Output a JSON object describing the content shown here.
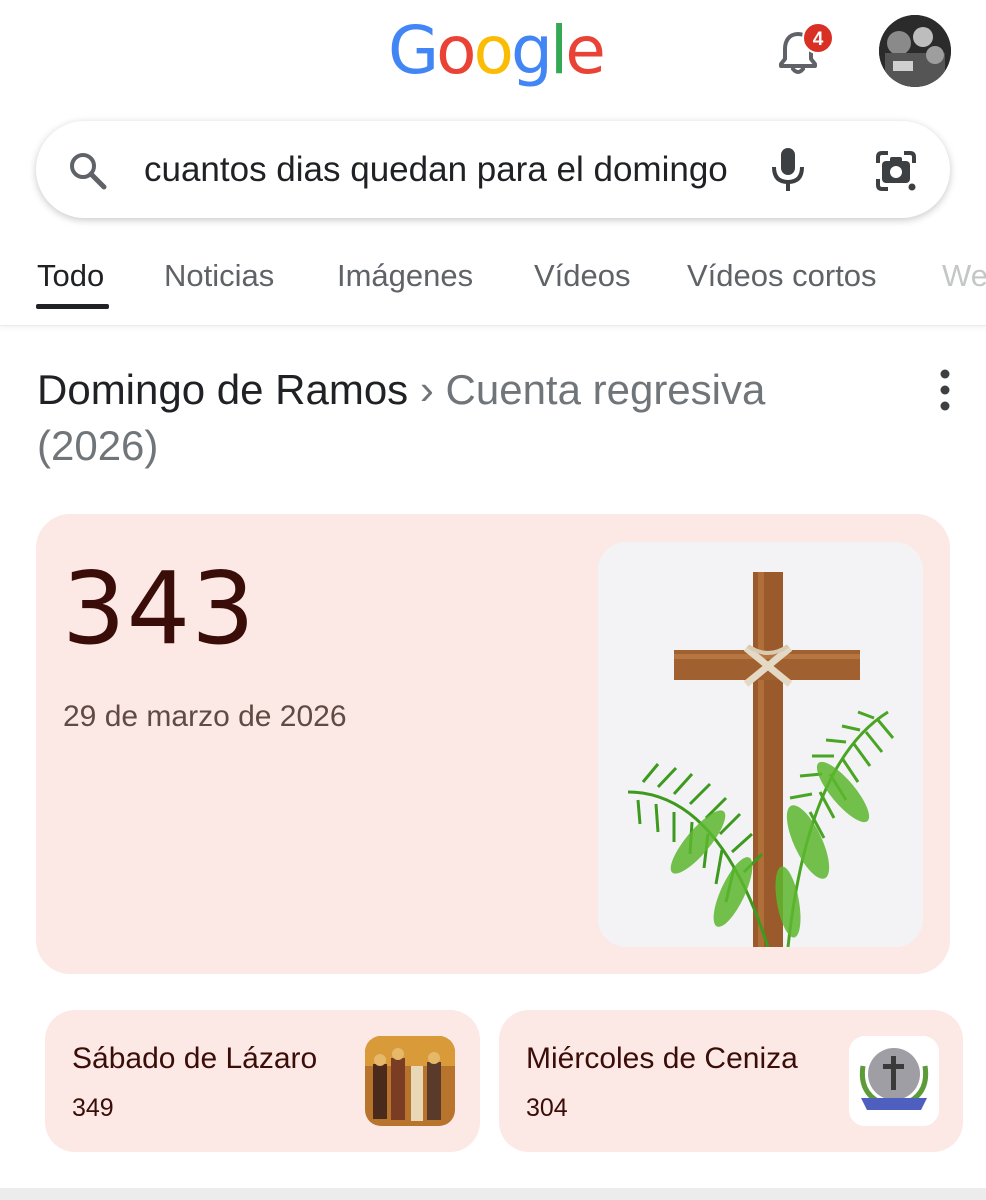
{
  "header": {
    "logo_text": "Google",
    "notification_count": "4",
    "avatar_label": ""
  },
  "search": {
    "query": "cuantos dias quedan para el domingo de ramos"
  },
  "tabs": [
    {
      "label": "Todo",
      "active": true
    },
    {
      "label": "Noticias"
    },
    {
      "label": "Imágenes"
    },
    {
      "label": "Vídeos"
    },
    {
      "label": "Vídeos cortos"
    },
    {
      "label": "Web"
    }
  ],
  "result": {
    "title_main": "Domingo de Ramos",
    "separator": "›",
    "title_sub": "Cuenta regresiva (2026)",
    "days_remaining": "343",
    "date": "29 de marzo de 2026"
  },
  "related": [
    {
      "title": "Sábado de Lázaro",
      "days": "349"
    },
    {
      "title": "Miércoles de Ceniza",
      "days": "304"
    }
  ],
  "colors": {
    "card_bg": "#fce8e4",
    "google_blue": "#4285f4",
    "google_red": "#ea4335",
    "google_yellow": "#fbbc05",
    "google_green": "#34a853",
    "badge_red": "#d93025"
  },
  "icons": {
    "search": "search-icon",
    "mic": "mic-icon",
    "lens": "camera-lens-icon",
    "bell": "bell-icon",
    "more": "more-vert-icon"
  }
}
